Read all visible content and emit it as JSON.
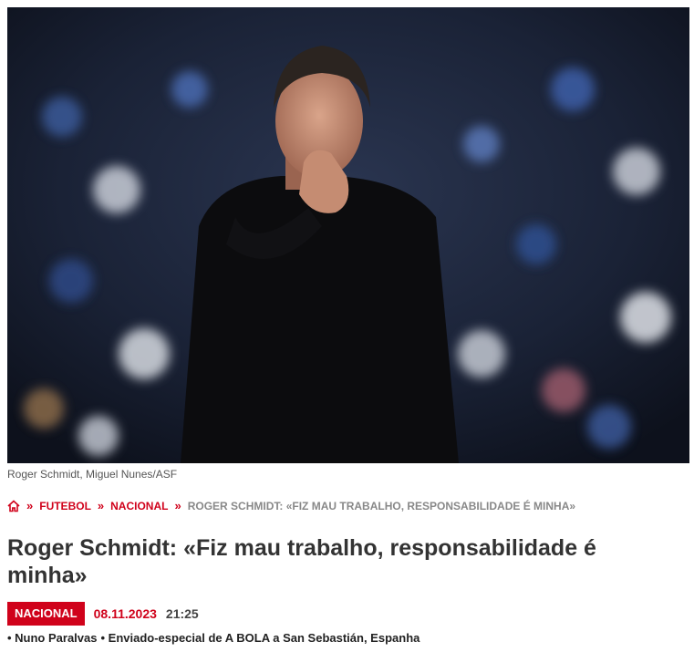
{
  "photo": {
    "caption": "Roger Schmidt, Miguel Nunes/ASF"
  },
  "breadcrumb": {
    "home_icon": "home-icon",
    "separator": "»",
    "items": [
      "FUTEBOL",
      "NACIONAL"
    ],
    "current": "ROGER SCHMIDT: «FIZ MAU TRABALHO, RESPONSABILIDADE É MINHA»"
  },
  "article": {
    "title": "Roger Schmidt: «Fiz mau trabalho, responsabilidade é minha»",
    "category": "NACIONAL",
    "date": "08.11.2023",
    "time": "21:25",
    "author": "• Nuno Paralvas",
    "role": "• Enviado-especial de A BOLA a San Sebastián, Espanha"
  },
  "colors": {
    "accent": "#d0021b",
    "text": "#333333"
  }
}
